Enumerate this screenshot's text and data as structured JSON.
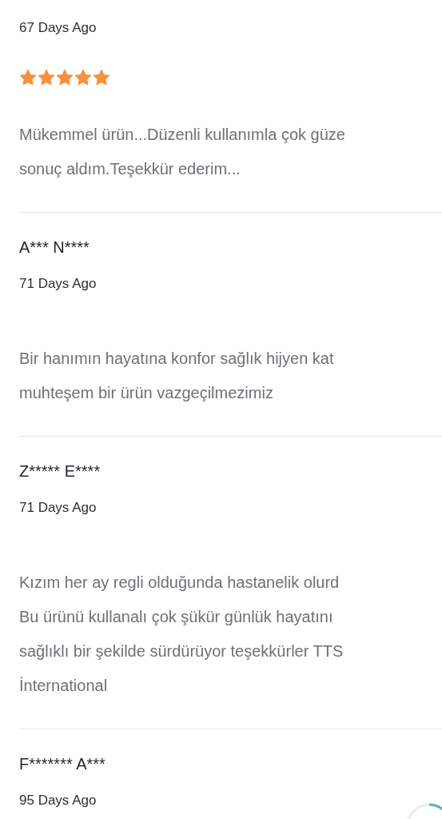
{
  "reviews": [
    {
      "date": "67 Days Ago",
      "stars": 5,
      "lines": [
        "Mükemmel ürün...Düzenli kullanımla çok güze",
        "sonuç aldım.Teşekkür ederim..."
      ]
    },
    {
      "name": "A*** N****",
      "date": "71 Days Ago",
      "lines": [
        "Bir hanımın hayatına konfor sağlık hijyen kat",
        "muhteşem bir ürün vazgeçilmezimiz"
      ]
    },
    {
      "name": "Z***** E****",
      "date": "71 Days Ago",
      "lines": [
        "Kızım her ay regli olduğunda hastanelik olurd",
        "Bu ürünü kullanalı çok şükür günlük hayatını",
        "sağlıklı bir şekilde sürdürüyor teşekkürler TTS",
        "İnternational"
      ]
    },
    {
      "name": "F******* A***",
      "date": "95 Days Ago"
    }
  ]
}
